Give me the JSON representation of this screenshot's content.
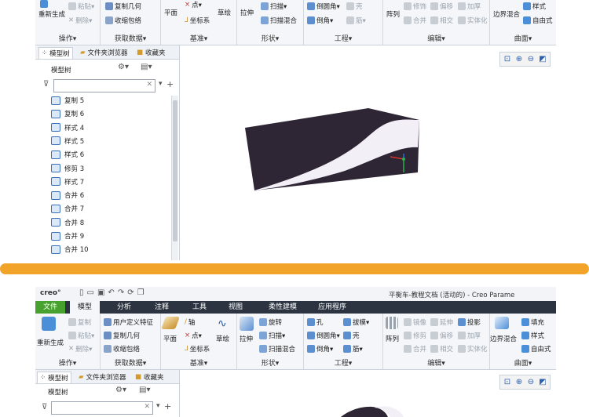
{
  "colors": {
    "accent_orange": "#f2a42a",
    "file_menu_green": "#47a12f",
    "menubar_bg": "#2b3440",
    "model_dark": "#2e2535",
    "model_light": "#f2eff6"
  },
  "top": {
    "groups": [
      {
        "title": "操作▾",
        "buttons": [
          "重新生成",
          "粘贴▾",
          "删除▾"
        ]
      },
      {
        "title": "获取数据▾",
        "buttons": [
          "复制几何",
          "收缩包络"
        ]
      },
      {
        "title": "基准▾",
        "buttons": [
          "平面",
          "点▾",
          "坐标系",
          "草绘"
        ]
      },
      {
        "title": "形状▾",
        "buttons": [
          "拉伸",
          "扫描▾",
          "扫描混合"
        ]
      },
      {
        "title": "工程▾",
        "buttons": [
          "倒圆角▾",
          "壳",
          "倒角▾",
          "筋▾"
        ]
      },
      {
        "title": "编辑▾",
        "buttons": [
          "阵列",
          "修饰",
          "偏移",
          "加厚",
          "修剪",
          "合并",
          "相交",
          "实体化"
        ]
      },
      {
        "title": "曲面▾",
        "buttons": [
          "边界混合",
          "样式",
          "自由式"
        ]
      }
    ],
    "tabs": [
      "模型树",
      "文件夹浏览器",
      "收藏夹"
    ],
    "tree_header": "模型树",
    "search_placeholder": "",
    "items": [
      "复制 5",
      "复制 6",
      "样式 4",
      "样式 5",
      "样式 6",
      "修剪 3",
      "样式 7",
      "合并 6",
      "合并 7",
      "合并 8",
      "合并 9",
      "合并 10"
    ]
  },
  "bottom": {
    "app_logo": "creo°",
    "window_title": "平衡车-教程文档 (活动的) - Creo Parame",
    "menus": [
      "文件",
      "模型",
      "分析",
      "注释",
      "工具",
      "视图",
      "柔性建模",
      "应用程序"
    ],
    "groups": [
      {
        "title": "操作▾",
        "buttons": [
          "复制",
          "粘贴▾",
          "重新生成",
          "删除▾"
        ]
      },
      {
        "title": "获取数据▾",
        "buttons": [
          "用户定义特征",
          "复制几何",
          "收缩包络"
        ]
      },
      {
        "title": "基准▾",
        "buttons": [
          "平面",
          "轴",
          "点▾",
          "坐标系",
          "草绘"
        ]
      },
      {
        "title": "形状▾",
        "buttons": [
          "拉伸",
          "旋转",
          "扫描▾",
          "扫描混合"
        ]
      },
      {
        "title": "工程▾",
        "buttons": [
          "孔",
          "拔模▾",
          "倒圆角▾",
          "壳",
          "倒角▾",
          "筋▾"
        ]
      },
      {
        "title": "编辑▾",
        "buttons": [
          "阵列",
          "镜像",
          "延伸",
          "投影",
          "修剪",
          "偏移",
          "加厚",
          "合并",
          "相交",
          "实体化"
        ]
      },
      {
        "title": "曲面▾",
        "buttons": [
          "边界混合",
          "填充",
          "样式",
          "自由式"
        ]
      }
    ],
    "tabs": [
      "模型树",
      "文件夹浏览器",
      "收藏夹"
    ],
    "tree_header": "模型树"
  }
}
